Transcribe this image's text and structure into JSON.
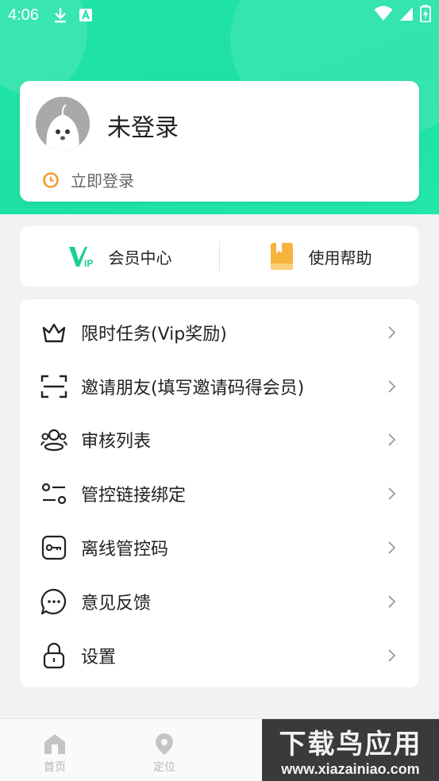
{
  "status_bar": {
    "time": "4:06"
  },
  "profile": {
    "name": "未登录",
    "login_link": "立即登录"
  },
  "quick_actions": [
    {
      "label": "会员中心",
      "icon": "vip-icon"
    },
    {
      "label": "使用帮助",
      "icon": "help-book-icon"
    }
  ],
  "menu": [
    {
      "label": "限时任务(Vip奖励)",
      "icon": "crown-icon"
    },
    {
      "label": "邀请朋友(填写邀请码得会员)",
      "icon": "scan-icon"
    },
    {
      "label": "审核列表",
      "icon": "users-icon"
    },
    {
      "label": "管控链接绑定",
      "icon": "sliders-icon"
    },
    {
      "label": "离线管控码",
      "icon": "key-icon"
    },
    {
      "label": "意见反馈",
      "icon": "chat-icon"
    },
    {
      "label": "设置",
      "icon": "lock-icon"
    }
  ],
  "tabbar": [
    {
      "label": "首页",
      "icon": "home-icon"
    },
    {
      "label": "定位",
      "icon": "location-icon"
    }
  ],
  "watermark": {
    "line1": "下载鸟应用",
    "line2": "www.xiazainiao.com"
  },
  "colors": {
    "accent": "#1fe3a6",
    "orange": "#f39a34",
    "vip_green": "#1ccf98"
  }
}
